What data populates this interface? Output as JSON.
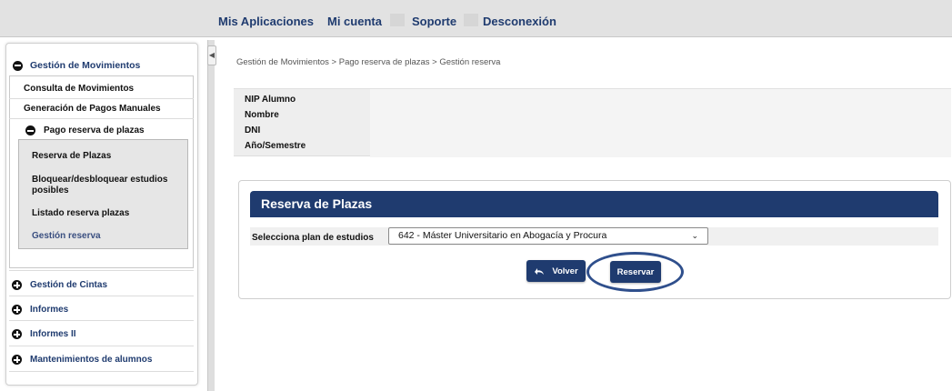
{
  "topnav": {
    "items": [
      "Mis Aplicaciones",
      "Mi cuenta",
      "Soporte",
      "Desconexión"
    ]
  },
  "sidebar": {
    "header": "Gestión de Movimientos",
    "links": [
      "Consulta de Movimientos",
      "Generación de Pagos Manuales"
    ],
    "sub_header": "Pago reserva de plazas",
    "sub_items": [
      "Reserva de Plazas",
      "Bloquear/desbloquear estudios posibles",
      "Listado reserva plazas",
      "Gestión reserva"
    ],
    "groups": [
      "Gestión de Cintas",
      "Informes",
      "Informes II",
      "Mantenimientos de alumnos"
    ]
  },
  "breadcrumb": "Gestión de Movimientos > Pago reserva de plazas > Gestión reserva",
  "info": {
    "labels": [
      "NIP Alumno",
      "Nombre",
      "DNI",
      "Año/Semestre"
    ]
  },
  "panel": {
    "title": "Reserva de Plazas",
    "plan_label": "Selecciona plan de estudios",
    "plan_selected": "642 - Máster Universitario en Abogacía y Procura",
    "volver_label": "Volver",
    "reservar_label": "Reservar"
  },
  "icons": {
    "collapse": "chevron-left-icon",
    "expanded": "minus-circle-icon",
    "collapsed": "plus-circle-icon",
    "undo": "undo-icon"
  },
  "colors": {
    "primary": "#1f3b6f",
    "highlight_ring": "#2f4f8c"
  }
}
